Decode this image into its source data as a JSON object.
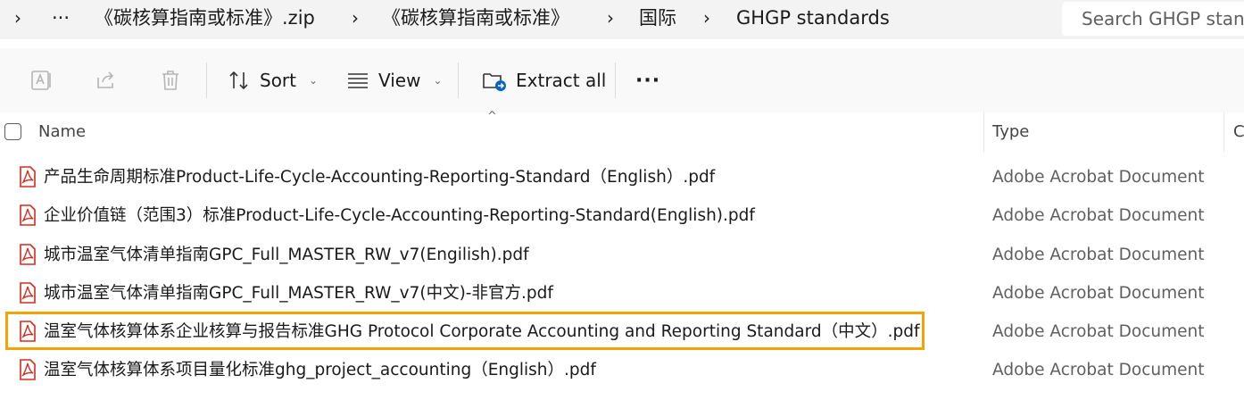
{
  "breadcrumb": {
    "expand_glyph": "›",
    "overflow": "···",
    "items": [
      "《碳核算指南或标准》.zip",
      "《碳核算指南或标准》",
      "国际",
      "GHGP standards"
    ],
    "separator": "›"
  },
  "search": {
    "placeholder": "Search GHGP standards"
  },
  "toolbar": {
    "sort_label": "Sort",
    "view_label": "View",
    "extract_label": "Extract all",
    "more_label": "···",
    "dropdown_glyph": "⌄"
  },
  "header": {
    "name_label": "Name",
    "type_label": "Type",
    "extra_label": "C",
    "sort_glyph": "^"
  },
  "files": [
    {
      "name": "产品生命周期标准Product-Life-Cycle-Accounting-Reporting-Standard（English）.pdf",
      "type": "Adobe Acrobat Document"
    },
    {
      "name": "企业价值链（范围3）标准Product-Life-Cycle-Accounting-Reporting-Standard(English).pdf",
      "type": "Adobe Acrobat Document"
    },
    {
      "name": "城市温室气体清单指南GPC_Full_MASTER_RW_v7(Engilish).pdf",
      "type": "Adobe Acrobat Document"
    },
    {
      "name": "城市温室气体清单指南GPC_Full_MASTER_RW_v7(中文)-非官方.pdf",
      "type": "Adobe Acrobat Document"
    },
    {
      "name": "温室气体核算体系企业核算与报告标准GHG Protocol Corporate Accounting and Reporting Standard（中文）.pdf",
      "type": "Adobe Acrobat Document"
    },
    {
      "name": "温室气体核算体系项目量化标准ghg_project_accounting（English）.pdf",
      "type": "Adobe Acrobat Document"
    }
  ],
  "colors": {
    "highlight": "#f5a300",
    "pdf_icon": "#d42b1e",
    "accent": "#0a64c8"
  }
}
